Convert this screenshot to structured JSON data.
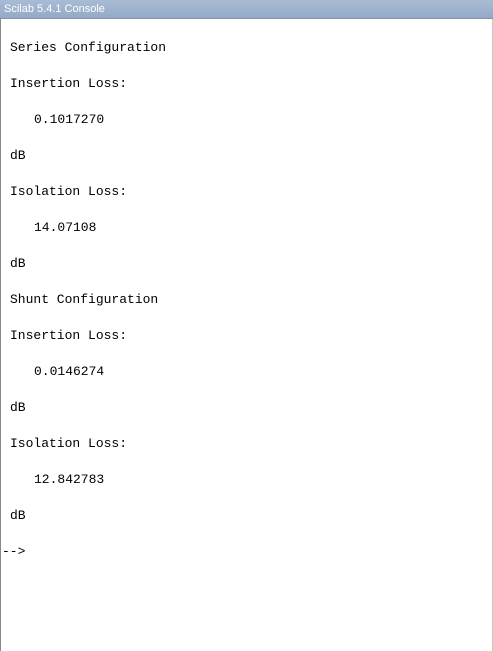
{
  "window": {
    "title": "Scilab 5.4.1 Console"
  },
  "console": {
    "lines": [
      "Series Configuration",
      "Insertion Loss:",
      "0.1017270",
      "dB",
      "Isolation Loss:",
      "14.07108",
      "dB",
      "Shunt Configuration",
      "Insertion Loss:",
      "0.0146274",
      "dB",
      "Isolation Loss:",
      "12.842783",
      "dB"
    ],
    "prompt": "-->"
  }
}
